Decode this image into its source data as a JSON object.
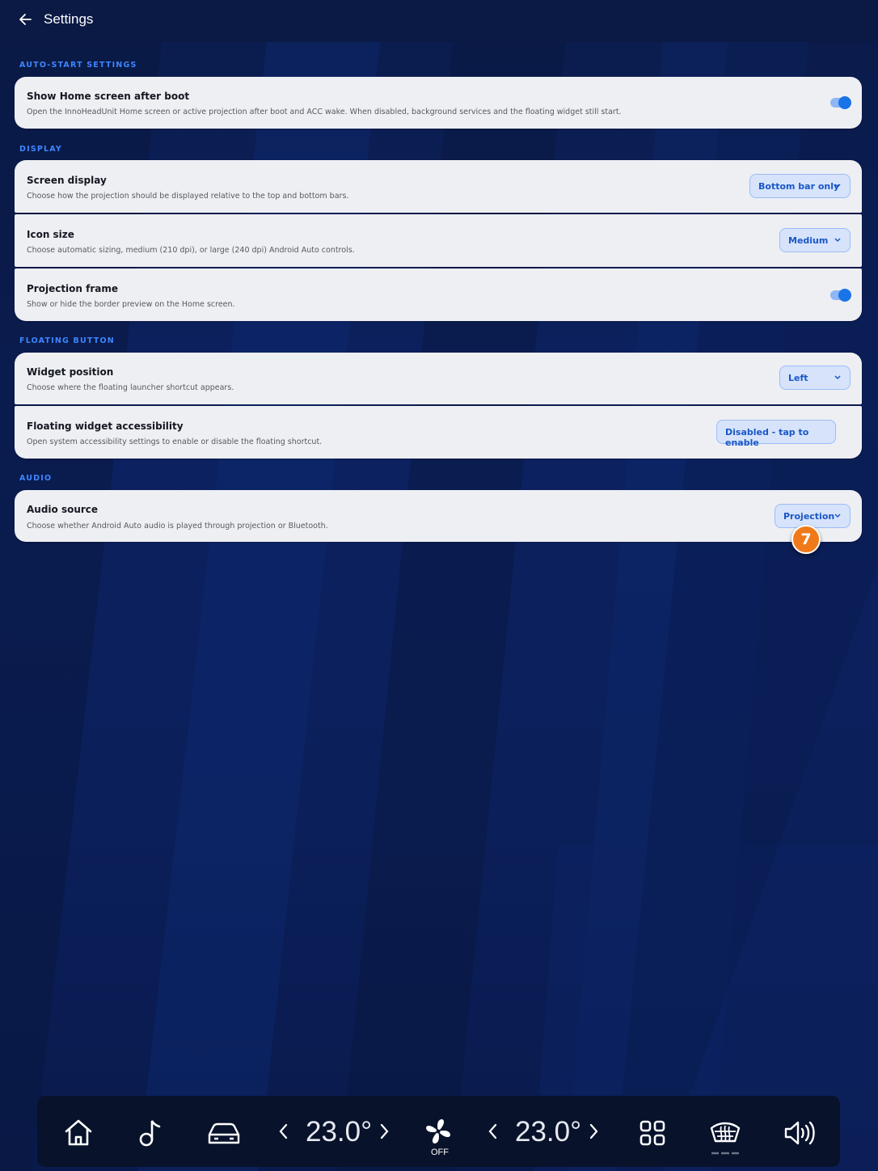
{
  "header": {
    "title": "Settings",
    "back_icon": "arrow-left-icon"
  },
  "sections": {
    "autostart": "AUTO-START SETTINGS",
    "display": "DISPLAY",
    "floating": "FLOATING BUTTON",
    "audio": "AUDIO"
  },
  "settings": {
    "show_home": {
      "title": "Show Home screen after boot",
      "desc": "Open the InnoHeadUnit Home screen or active projection after boot and ACC wake. When disabled, background services and the floating widget still start.",
      "enabled": true
    },
    "screen_display": {
      "title": "Screen display",
      "desc": "Choose how the projection should be displayed relative to the top and bottom bars.",
      "value": "Bottom bar only"
    },
    "icon_size": {
      "title": "Icon size",
      "desc": "Choose automatic sizing, medium (210 dpi), or large (240 dpi) Android Auto controls.",
      "value": "Medium"
    },
    "projection_frame": {
      "title": "Projection frame",
      "desc": "Show or hide the border preview on the Home screen.",
      "enabled": true
    },
    "widget_position": {
      "title": "Widget position",
      "desc": "Choose where the floating launcher shortcut appears.",
      "value": "Left"
    },
    "floating_accessibility": {
      "title": "Floating widget accessibility",
      "desc": "Open system accessibility settings to enable or disable the floating shortcut.",
      "button": "Disabled - tap to enable"
    },
    "audio_source": {
      "title": "Audio source",
      "desc": "Choose whether Android Auto audio is played through projection or Bluetooth.",
      "value": "Projection"
    }
  },
  "badge": {
    "number": "7"
  },
  "dock": {
    "left_temp": "23.0°",
    "right_temp": "23.0°",
    "fan_status": "OFF",
    "icons": [
      "home-icon",
      "music-note-icon",
      "car-icon",
      "chevron-left-icon",
      "chevron-right-icon",
      "fan-icon",
      "apps-grid-icon",
      "rear-defrost-icon",
      "volume-icon"
    ]
  },
  "colors": {
    "accent": "#1a73e8",
    "section_label": "#3e86ff",
    "card_bg": "#eeeff3",
    "badge": "#f07a1a",
    "dock_bg": "#08122b"
  }
}
